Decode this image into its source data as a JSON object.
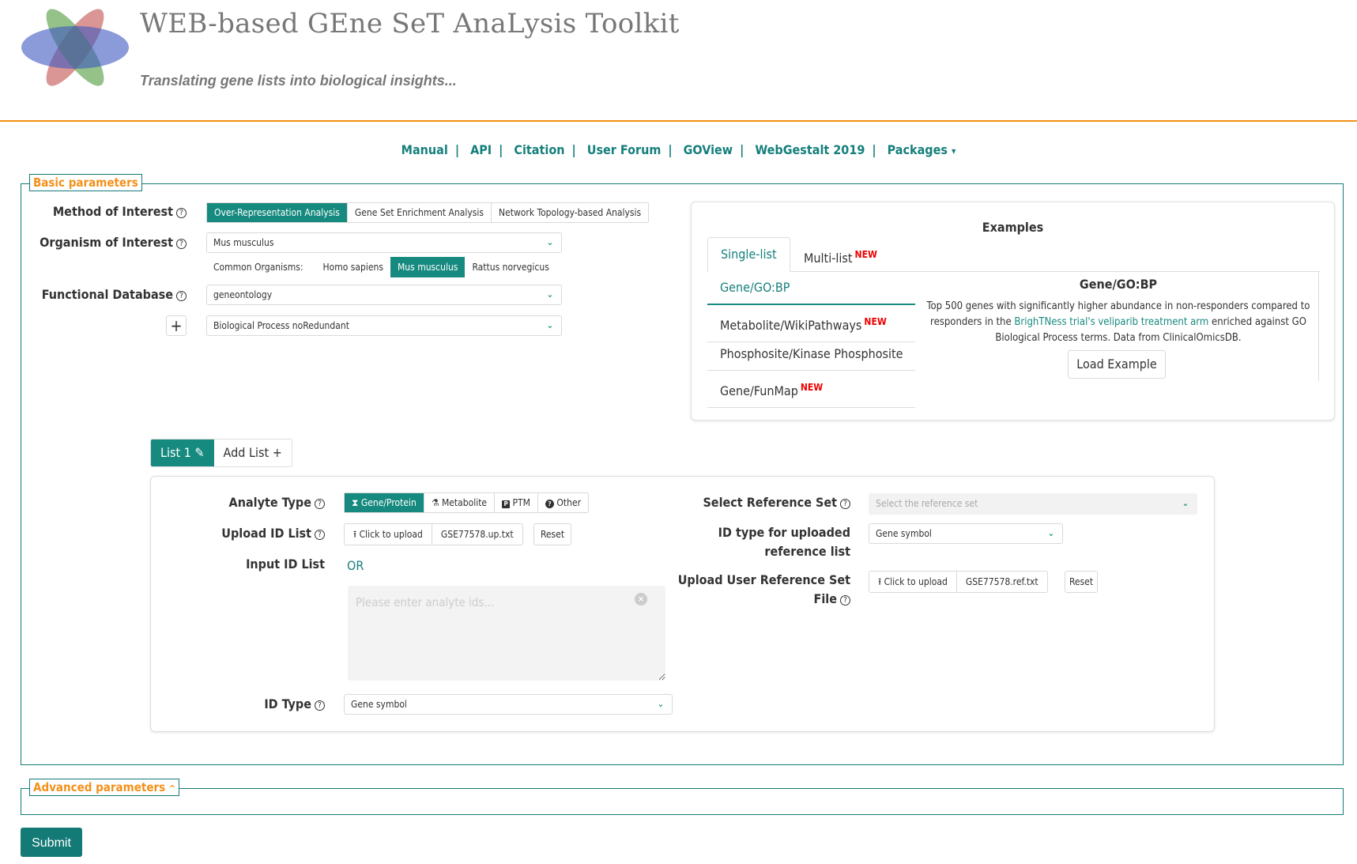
{
  "header": {
    "title": "WEB-based GEne SeT AnaLysis Toolkit",
    "tagline": "Translating gene lists into biological insights..."
  },
  "nav": {
    "items": [
      "Manual",
      "API",
      "Citation",
      "User Forum",
      "GOView",
      "WebGestalt 2019",
      "Packages"
    ],
    "separator": "|",
    "dropdown_caret": "▾"
  },
  "basic": {
    "legend": "Basic parameters",
    "method_label": "Method of Interest",
    "methods": [
      "Over-Representation Analysis",
      "Gene Set Enrichment Analysis",
      "Network Topology-based Analysis"
    ],
    "method_selected": "Over-Representation Analysis",
    "organism_label": "Organism of Interest",
    "organism_value": "Mus musculus",
    "common_organisms_label": "Common Organisms:",
    "common_organisms": [
      "Homo sapiens",
      "Mus musculus",
      "Rattus norvegicus"
    ],
    "common_selected": "Mus musculus",
    "database_label": "Functional Database",
    "database_value": "geneontology",
    "database_sub_value": "Biological Process noRedundant",
    "add_database_symbol": "+"
  },
  "examples": {
    "title": "Examples",
    "tabs": [
      {
        "label": "Single-list",
        "new": false
      },
      {
        "label": "Multi-list",
        "new": true
      }
    ],
    "active_tab": "Single-list",
    "new_badge": "NEW",
    "items": [
      {
        "label": "Gene/GO:BP",
        "new": false
      },
      {
        "label": "Metabolite/WikiPathways",
        "new": true
      },
      {
        "label": "Phosphosite/Kinase Phosphosite",
        "new": false
      },
      {
        "label": "Gene/FunMap",
        "new": true
      }
    ],
    "active_item": "Gene/GO:BP",
    "detail_title": "Gene/GO:BP",
    "detail_text_before": "Top 500 genes with significantly higher abundance in non-responders compared to responders in the ",
    "detail_link": "BrighTNess trial's veliparib treatment arm",
    "detail_text_after": " enriched against GO Biological Process terms. Data from ClinicalOmicsDB.",
    "load_button": "Load Example"
  },
  "lists": {
    "list1_label": "List 1",
    "add_list_label": "Add List",
    "analyte_label": "Analyte Type",
    "analyte_types": [
      "Gene/Protein",
      "Metabolite",
      "PTM",
      "Other"
    ],
    "analyte_selected": "Gene/Protein",
    "upload_label": "Upload ID List",
    "upload_button": "Click to upload",
    "upload_filename": "GSE77578.up.txt",
    "reset_label": "Reset",
    "input_label": "Input ID List",
    "or_label": "OR",
    "ids_placeholder": "Please enter analyte ids...",
    "ids_value": "",
    "idtype_label": "ID Type",
    "idtype_value": "Gene symbol",
    "refset_label": "Select Reference Set",
    "refset_placeholder": "Select the reference set",
    "ref_idtype_label_1": "ID type for uploaded",
    "ref_idtype_label_2": "reference list",
    "ref_idtype_value": "Gene symbol",
    "ref_upload_label_1": "Upload User Reference Set",
    "ref_upload_label_2": "File",
    "ref_upload_button": "Click to upload",
    "ref_upload_filename": "GSE77578.ref.txt",
    "ref_reset_label": "Reset"
  },
  "advanced": {
    "legend": "Advanced parameters",
    "caret": "^"
  },
  "submit_label": "Submit",
  "colors": {
    "teal": "#178a7f",
    "orange": "#f39019",
    "new_red": "#e00000"
  }
}
